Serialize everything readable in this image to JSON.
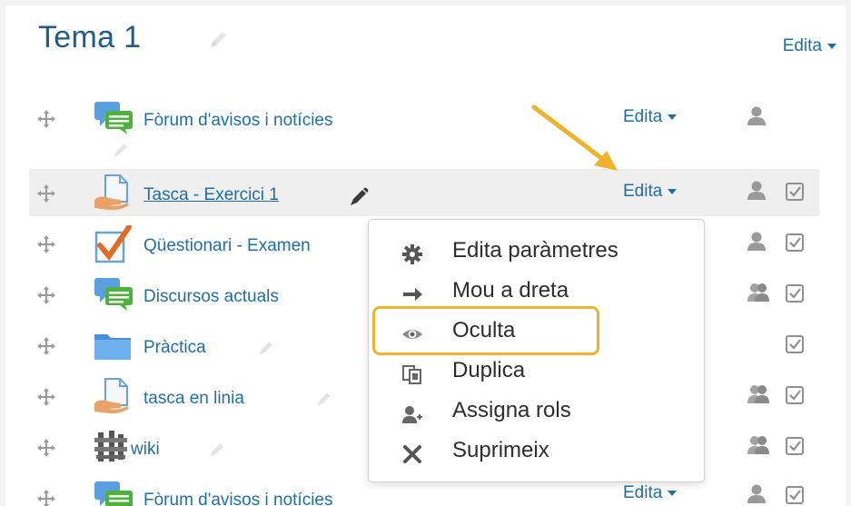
{
  "section": {
    "title": "Tema 1",
    "edit_label": "Edita"
  },
  "activities": [
    {
      "name": "Fòrum d'avisos i notícies",
      "edit_label": "Edita"
    },
    {
      "name": "Tasca - Exercici 1",
      "edit_label": "Edita"
    },
    {
      "name": "Qüestionari - Examen"
    },
    {
      "name": "Discursos actuals"
    },
    {
      "name": "Pràctica"
    },
    {
      "name": "tasca en linia"
    },
    {
      "name": "wiki"
    },
    {
      "name": "Fòrum d'avisos i notícies",
      "edit_label": "Edita"
    }
  ],
  "menu": {
    "items": [
      {
        "label": "Edita paràmetres",
        "icon": "gear-icon"
      },
      {
        "label": "Mou a dreta",
        "icon": "arrow-right-icon"
      },
      {
        "label": "Oculta",
        "icon": "eye-icon"
      },
      {
        "label": "Duplica",
        "icon": "duplicate-icon"
      },
      {
        "label": "Assigna rols",
        "icon": "assign-roles-icon"
      },
      {
        "label": "Suprimeix",
        "icon": "delete-icon"
      }
    ]
  },
  "colors": {
    "link": "#1f6fa5",
    "title": "#1f5c8b",
    "highlight": "#f0b22a",
    "row_highlight": "#efefef"
  }
}
